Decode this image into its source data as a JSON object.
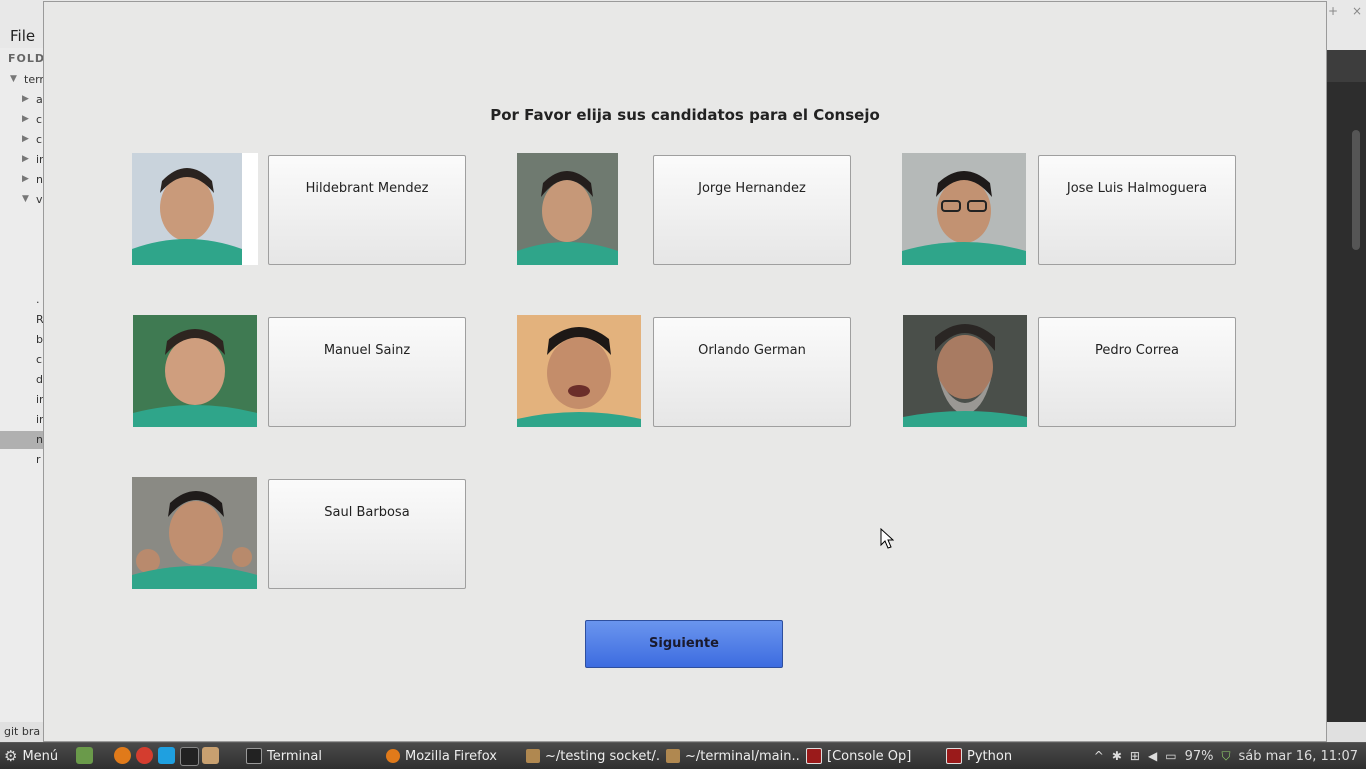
{
  "editor": {
    "menu_file": "File",
    "folders_header": "FOLDE",
    "tree": [
      {
        "label": "terr",
        "arrow": "▼",
        "root": true
      },
      {
        "label": "a",
        "arrow": "▶"
      },
      {
        "label": "c",
        "arrow": "▶"
      },
      {
        "label": "c",
        "arrow": "▶"
      },
      {
        "label": "ir",
        "arrow": "▶"
      },
      {
        "label": "n",
        "arrow": "▶"
      },
      {
        "label": "v",
        "arrow": "▼"
      }
    ],
    "files": [
      ".",
      "R",
      "b",
      "c",
      "d",
      "ir",
      "ir",
      "n",
      "r"
    ],
    "status_text": "git bra"
  },
  "dialog": {
    "title": "Por Favor elija sus candidatos para el Consejo",
    "candidates": [
      {
        "name": "Hildebrant Mendez"
      },
      {
        "name": "Jorge Hernandez"
      },
      {
        "name": "Jose Luis Halmoguera"
      },
      {
        "name": "Manuel Sainz"
      },
      {
        "name": "Orlando German"
      },
      {
        "name": "Pedro Correa"
      },
      {
        "name": "Saul Barbosa"
      }
    ],
    "next_label": "Siguiente"
  },
  "taskbar": {
    "menu_label": "Menú",
    "tasks": [
      {
        "label": "Terminal",
        "icon": "terminal-icon"
      },
      {
        "label": "Mozilla Firefox",
        "icon": "firefox-icon"
      },
      {
        "label": "~/testing socket/...",
        "icon": "folder-icon"
      },
      {
        "label": "~/terminal/main....",
        "icon": "folder-icon"
      },
      {
        "label": "[Console Op]",
        "icon": "console-icon"
      },
      {
        "label": "Python",
        "icon": "python-icon"
      }
    ],
    "battery": "97%",
    "clock": "sáb mar 16, 11:07"
  },
  "colors": {
    "dialog_bg": "#e8e8e7",
    "next_button": "#4f7de6",
    "uniform_green": "#2fa58a"
  }
}
